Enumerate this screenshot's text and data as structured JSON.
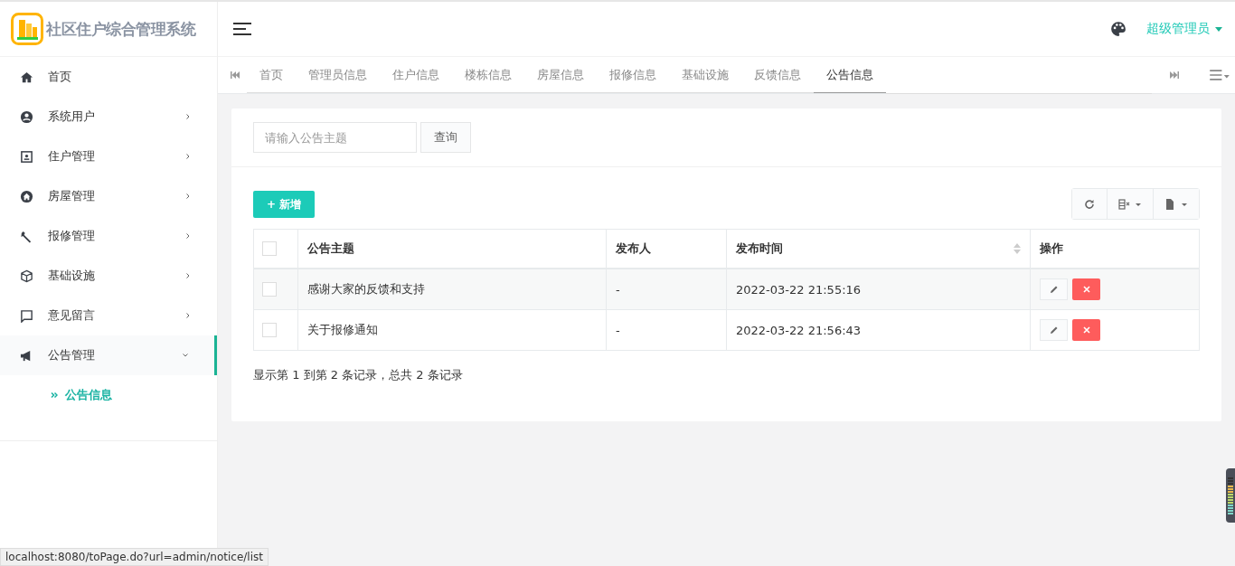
{
  "brand": {
    "title": "社区住户综合管理系统"
  },
  "header": {
    "user": "超级管理员"
  },
  "sidebar": {
    "items": [
      {
        "label": "首页",
        "has_submenu": false,
        "expanded": false,
        "selected": false
      },
      {
        "label": "系统用户",
        "has_submenu": true,
        "expanded": false,
        "selected": false
      },
      {
        "label": "住户管理",
        "has_submenu": true,
        "expanded": false,
        "selected": false
      },
      {
        "label": "房屋管理",
        "has_submenu": true,
        "expanded": false,
        "selected": false
      },
      {
        "label": "报修管理",
        "has_submenu": true,
        "expanded": false,
        "selected": false
      },
      {
        "label": "基础设施",
        "has_submenu": true,
        "expanded": false,
        "selected": false
      },
      {
        "label": "意见留言",
        "has_submenu": true,
        "expanded": false,
        "selected": false
      },
      {
        "label": "公告管理",
        "has_submenu": true,
        "expanded": true,
        "selected": true,
        "children": [
          {
            "label": "公告信息",
            "selected": true
          }
        ]
      }
    ]
  },
  "tabs": [
    {
      "label": "首页",
      "selected": false
    },
    {
      "label": "管理员信息",
      "selected": false
    },
    {
      "label": "住户信息",
      "selected": false
    },
    {
      "label": "楼栋信息",
      "selected": false
    },
    {
      "label": "房屋信息",
      "selected": false
    },
    {
      "label": "报修信息",
      "selected": false
    },
    {
      "label": "基础设施",
      "selected": false
    },
    {
      "label": "反馈信息",
      "selected": false
    },
    {
      "label": "公告信息",
      "selected": true
    }
  ],
  "search": {
    "placeholder": "请输入公告主题",
    "button": "查询"
  },
  "add_button": "+ 新增",
  "table": {
    "select_all_checked": false,
    "columns": [
      "公告主题",
      "发布人",
      "发布时间",
      "操作"
    ],
    "rows": [
      {
        "checked": false,
        "cells": [
          "感谢大家的反馈和支持",
          "-",
          "2022-03-22 21:55:16"
        ]
      },
      {
        "checked": false,
        "cells": [
          "关于报修通知",
          "-",
          "2022-03-22 21:56:43"
        ]
      }
    ]
  },
  "pagination_info": "显示第 1 到第 2 条记录，总共 2 条记录",
  "status_bar": {
    "url": "localhost:8080/toPage.do?url=admin/notice/list"
  }
}
